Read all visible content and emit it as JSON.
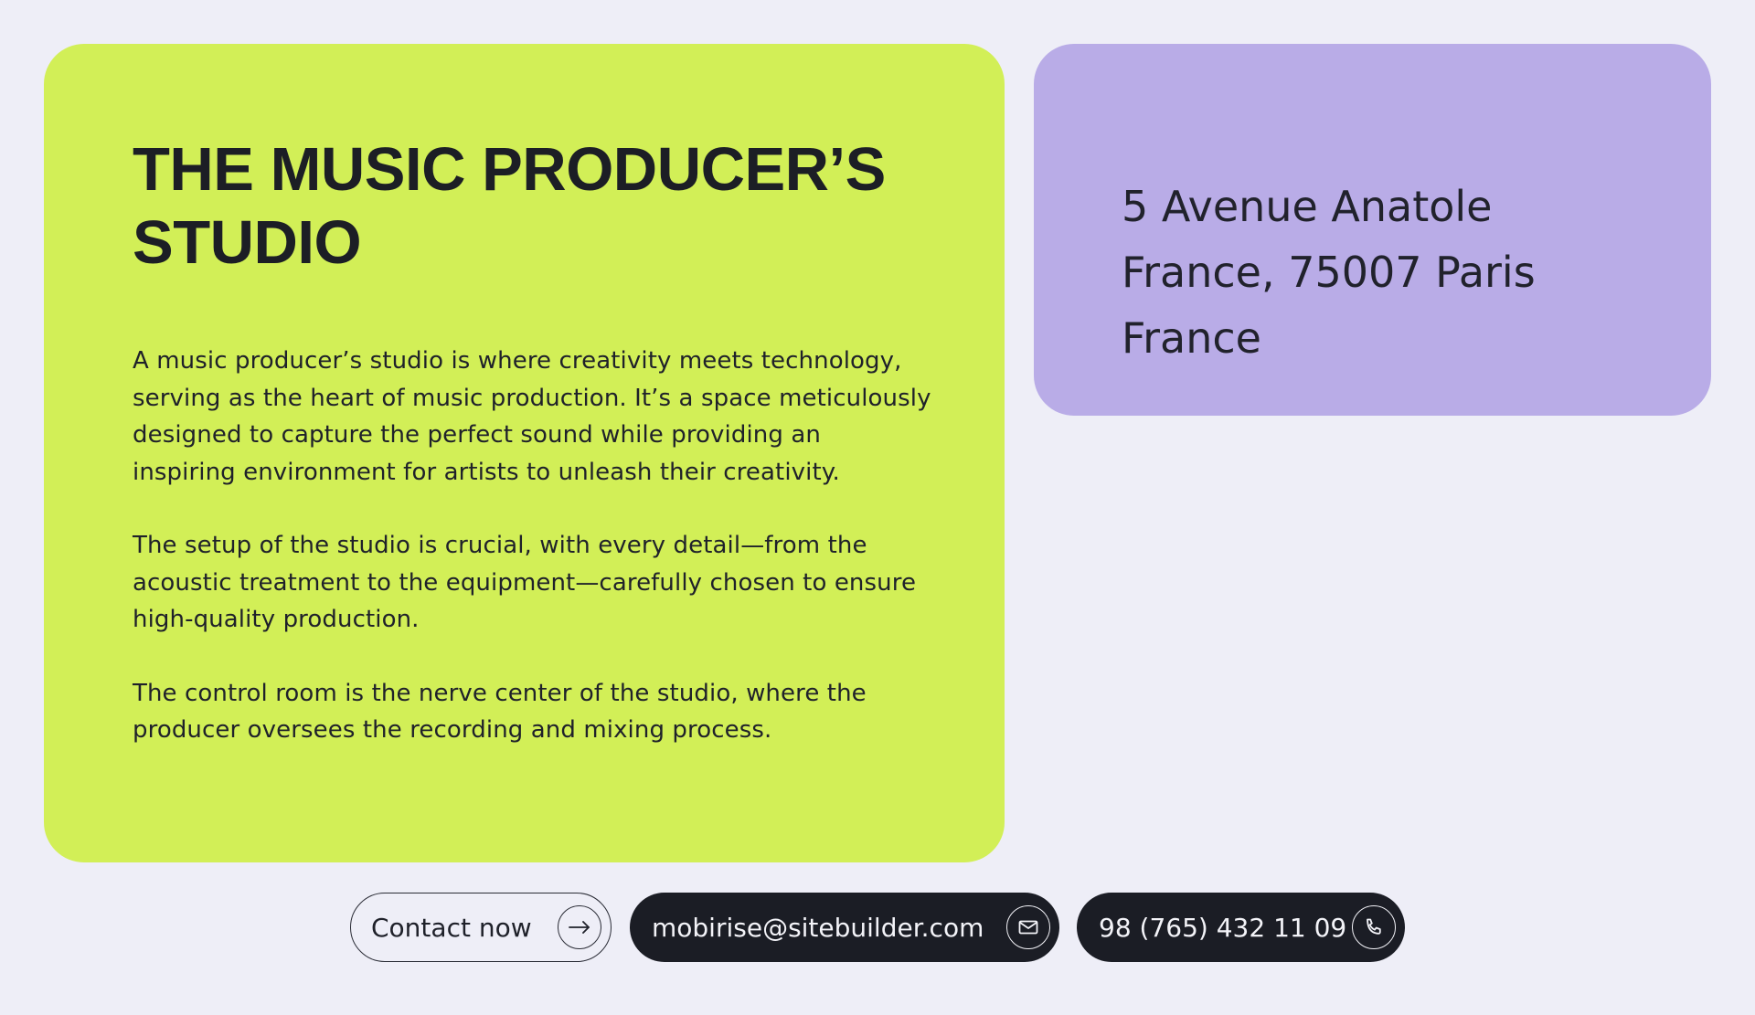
{
  "studio": {
    "title": "THE MUSIC PRODUCER’S STUDIO",
    "paragraphs": [
      "A music producer’s studio is where creativity meets technology, serving as the heart of music production. It’s a space meticulously designed to capture the perfect sound while providing an inspiring environment for artists to unleash their creativity.",
      "The setup of the studio is crucial, with every detail—from the acoustic treatment to the equipment—carefully chosen to ensure high-quality production.",
      "The control room is the nerve center of the studio, where the producer oversees the recording and mixing process."
    ]
  },
  "address": {
    "text": "5 Avenue Anatole France, 75007 Paris France"
  },
  "actions": {
    "contact": {
      "label": "Contact now",
      "icon": "arrow-right-icon"
    },
    "email": {
      "label": "mobirise@sitebuilder.com",
      "icon": "envelope-icon"
    },
    "phone": {
      "label": "98 (765) 432 11 09",
      "icon": "phone-icon"
    }
  },
  "colors": {
    "background": "#eeeef7",
    "card_green": "#d2ef57",
    "card_purple": "#b9ace7",
    "dark": "#1b1d25"
  }
}
